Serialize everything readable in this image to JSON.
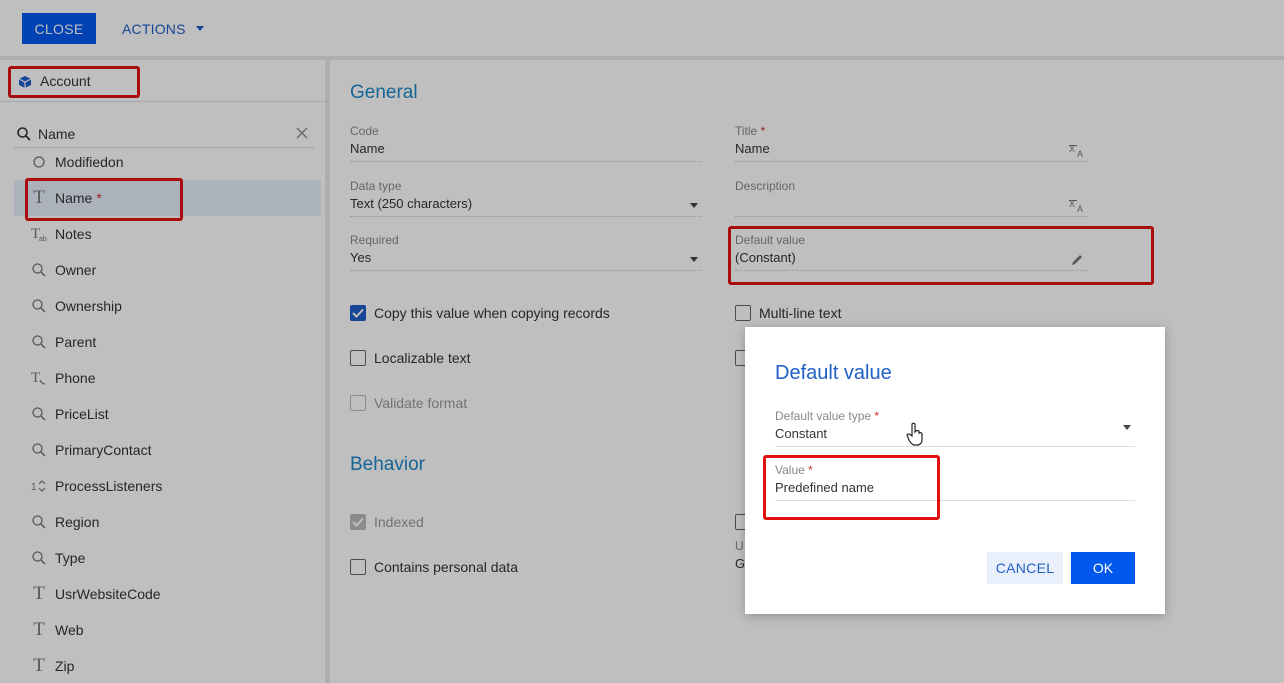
{
  "toolbar": {
    "close_label": "CLOSE",
    "actions_label": "ACTIONS"
  },
  "entity": {
    "label": "Account"
  },
  "search": {
    "value": "Name"
  },
  "list": {
    "partial_item": "Modifiedon",
    "items": [
      {
        "icon": "text-icon",
        "label": "Name",
        "required": "*"
      },
      {
        "icon": "multiline-text-icon",
        "label": "Notes"
      },
      {
        "icon": "lookup-icon",
        "label": "Owner"
      },
      {
        "icon": "lookup-icon",
        "label": "Ownership"
      },
      {
        "icon": "lookup-icon",
        "label": "Parent"
      },
      {
        "icon": "phone-text-icon",
        "label": "Phone"
      },
      {
        "icon": "lookup-icon",
        "label": "PriceList"
      },
      {
        "icon": "lookup-icon",
        "label": "PrimaryContact"
      },
      {
        "icon": "integer-icon",
        "label": "ProcessListeners"
      },
      {
        "icon": "lookup-icon",
        "label": "Region"
      },
      {
        "icon": "lookup-icon",
        "label": "Type"
      },
      {
        "icon": "text-icon",
        "label": "UsrWebsiteCode"
      },
      {
        "icon": "text-icon",
        "label": "Web"
      },
      {
        "icon": "text-icon",
        "label": "Zip"
      }
    ]
  },
  "general": {
    "title": "General",
    "code": {
      "label": "Code",
      "value": "Name"
    },
    "title_field": {
      "label": "Title",
      "required": "*",
      "value": "Name"
    },
    "data_type": {
      "label": "Data type",
      "value": "Text (250 characters)"
    },
    "description": {
      "label": "Description",
      "value": ""
    },
    "required": {
      "label": "Required",
      "value": "Yes"
    },
    "default_value": {
      "label": "Default value",
      "value": "(Constant)"
    },
    "copy_value": {
      "label": "Copy this value when copying records",
      "checked": true
    },
    "multiline": {
      "label": "Multi-line text",
      "checked": false
    },
    "localizable": {
      "label": "Localizable text",
      "checked": false
    },
    "validate": {
      "label": "Validate format",
      "checked": false
    }
  },
  "behavior": {
    "title": "Behavior",
    "indexed": {
      "label": "Indexed",
      "checked": true
    },
    "personal": {
      "label": "Contains personal data",
      "checked": false
    },
    "partial_value": "G",
    "partial_label": "U"
  },
  "dialog": {
    "title": "Default value",
    "type_field": {
      "label": "Default value type",
      "required": "*",
      "value": "Constant"
    },
    "value_field": {
      "label": "Value",
      "required": "*",
      "value": "Predefined name"
    },
    "cancel_label": "CANCEL",
    "ok_label": "OK"
  },
  "colors": {
    "accent": "#0058ef",
    "link": "#1e5fc8",
    "section": "#1e88c7",
    "highlight": "#e01010",
    "required": "#d32f2f"
  }
}
